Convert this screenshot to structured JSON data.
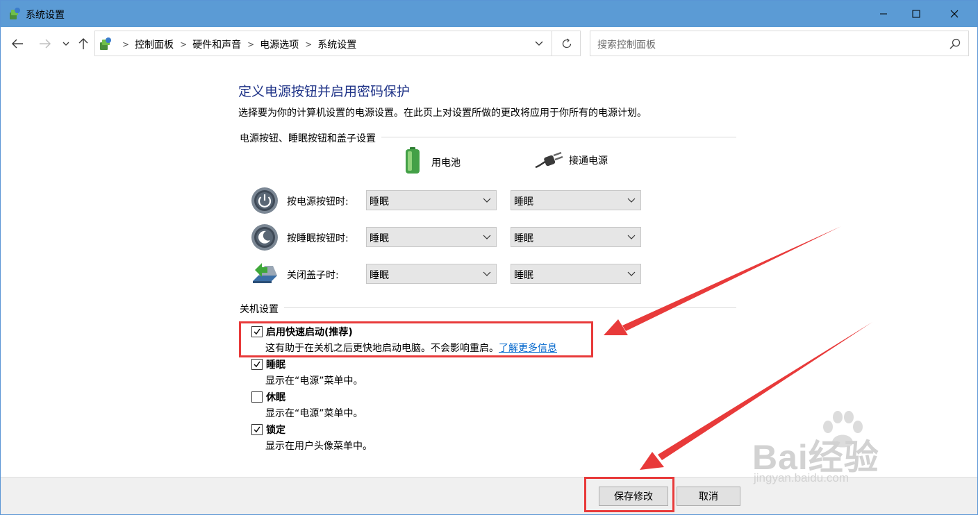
{
  "window": {
    "title": "系统设置"
  },
  "breadcrumb": [
    "控制面板",
    "硬件和声音",
    "电源选项",
    "系统设置"
  ],
  "search": {
    "placeholder": "搜索控制面板"
  },
  "page": {
    "title": "定义电源按钮并启用密码保护",
    "description": "选择要为你的计算机设置的电源设置。在此页上对设置所做的更改将应用于你所有的电源计划。"
  },
  "power_buttons": {
    "section_title": "电源按钮、睡眠按钮和盖子设置",
    "columns": {
      "battery": "用电池",
      "plugged_in": "接通电源"
    },
    "rows": [
      {
        "label": "按电源按钮时:",
        "battery": "睡眠",
        "plugged_in": "睡眠",
        "icon": "power-icon"
      },
      {
        "label": "按睡眠按钮时:",
        "battery": "睡眠",
        "plugged_in": "睡眠",
        "icon": "sleep-icon"
      },
      {
        "label": "关闭盖子时:",
        "battery": "睡眠",
        "plugged_in": "睡眠",
        "icon": "lid-close-icon"
      }
    ]
  },
  "shutdown": {
    "section_title": "关机设置",
    "items": [
      {
        "label": "启用快速启动(推荐)",
        "checked": true,
        "description": "这有助于在关机之后更快地启动电脑。不会影响重启。",
        "link": "了解更多信息"
      },
      {
        "label": "睡眠",
        "checked": true,
        "description": "显示在“电源”菜单中。"
      },
      {
        "label": "休眠",
        "checked": false,
        "description": "显示在“电源”菜单中。"
      },
      {
        "label": "锁定",
        "checked": true,
        "description": "显示在用户头像菜单中。"
      }
    ]
  },
  "footer": {
    "save_label": "保存修改",
    "cancel_label": "取消"
  },
  "watermark": {
    "brand": "Bai经验",
    "url": "jingyan.baidu.com"
  },
  "colors": {
    "titlebar": "#5b9bd5",
    "heading": "#1e3287",
    "link": "#0066cc",
    "annotation": "#e83a3a"
  }
}
